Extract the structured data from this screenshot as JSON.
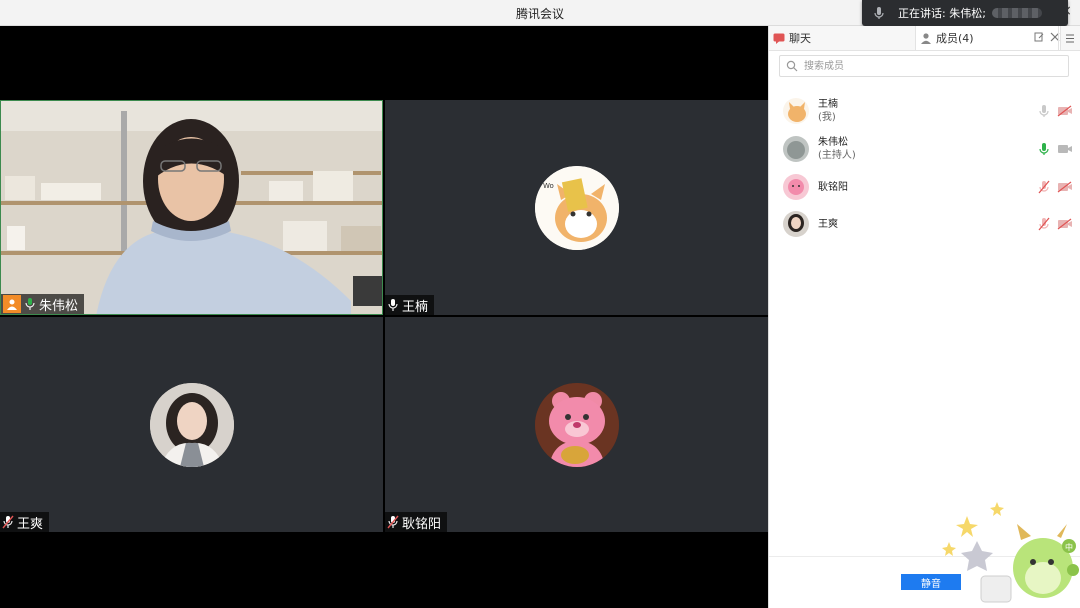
{
  "window": {
    "title": "腾讯会议",
    "close_glyph": "×"
  },
  "speaking_banner": {
    "label": "正在讲话: 朱伟松;"
  },
  "tiles": [
    {
      "name": "朱伟松",
      "is_host": true,
      "mic": "on",
      "video": true
    },
    {
      "name": "王楠",
      "mic": "on",
      "video": false,
      "avatar": "cartoon-cat"
    },
    {
      "name": "王爽",
      "mic": "muted",
      "video": false,
      "avatar": "photo-girl"
    },
    {
      "name": "耿铭阳",
      "mic": "muted",
      "video": false,
      "avatar": "pink-bear"
    }
  ],
  "panel": {
    "tab_chat": "聊天",
    "tab_members": "成员(4)",
    "search_placeholder": "搜索成员",
    "members": [
      {
        "name": "王楠",
        "sub": "(我)",
        "mic": "idle",
        "cam": "off"
      },
      {
        "name": "朱伟松",
        "sub": "(主持人)",
        "mic": "active",
        "cam": "on"
      },
      {
        "name": "耿铭阳",
        "sub": "",
        "mic": "muted",
        "cam": "off"
      },
      {
        "name": "王爽",
        "sub": "",
        "mic": "muted",
        "cam": "off"
      }
    ],
    "mute_button": "静音"
  },
  "colors": {
    "accent": "#1e7bf0",
    "host_badge": "#f28c28",
    "active_mic": "#2eb24a",
    "muted": "#e05555",
    "tile_bg": "#2b2e33"
  }
}
